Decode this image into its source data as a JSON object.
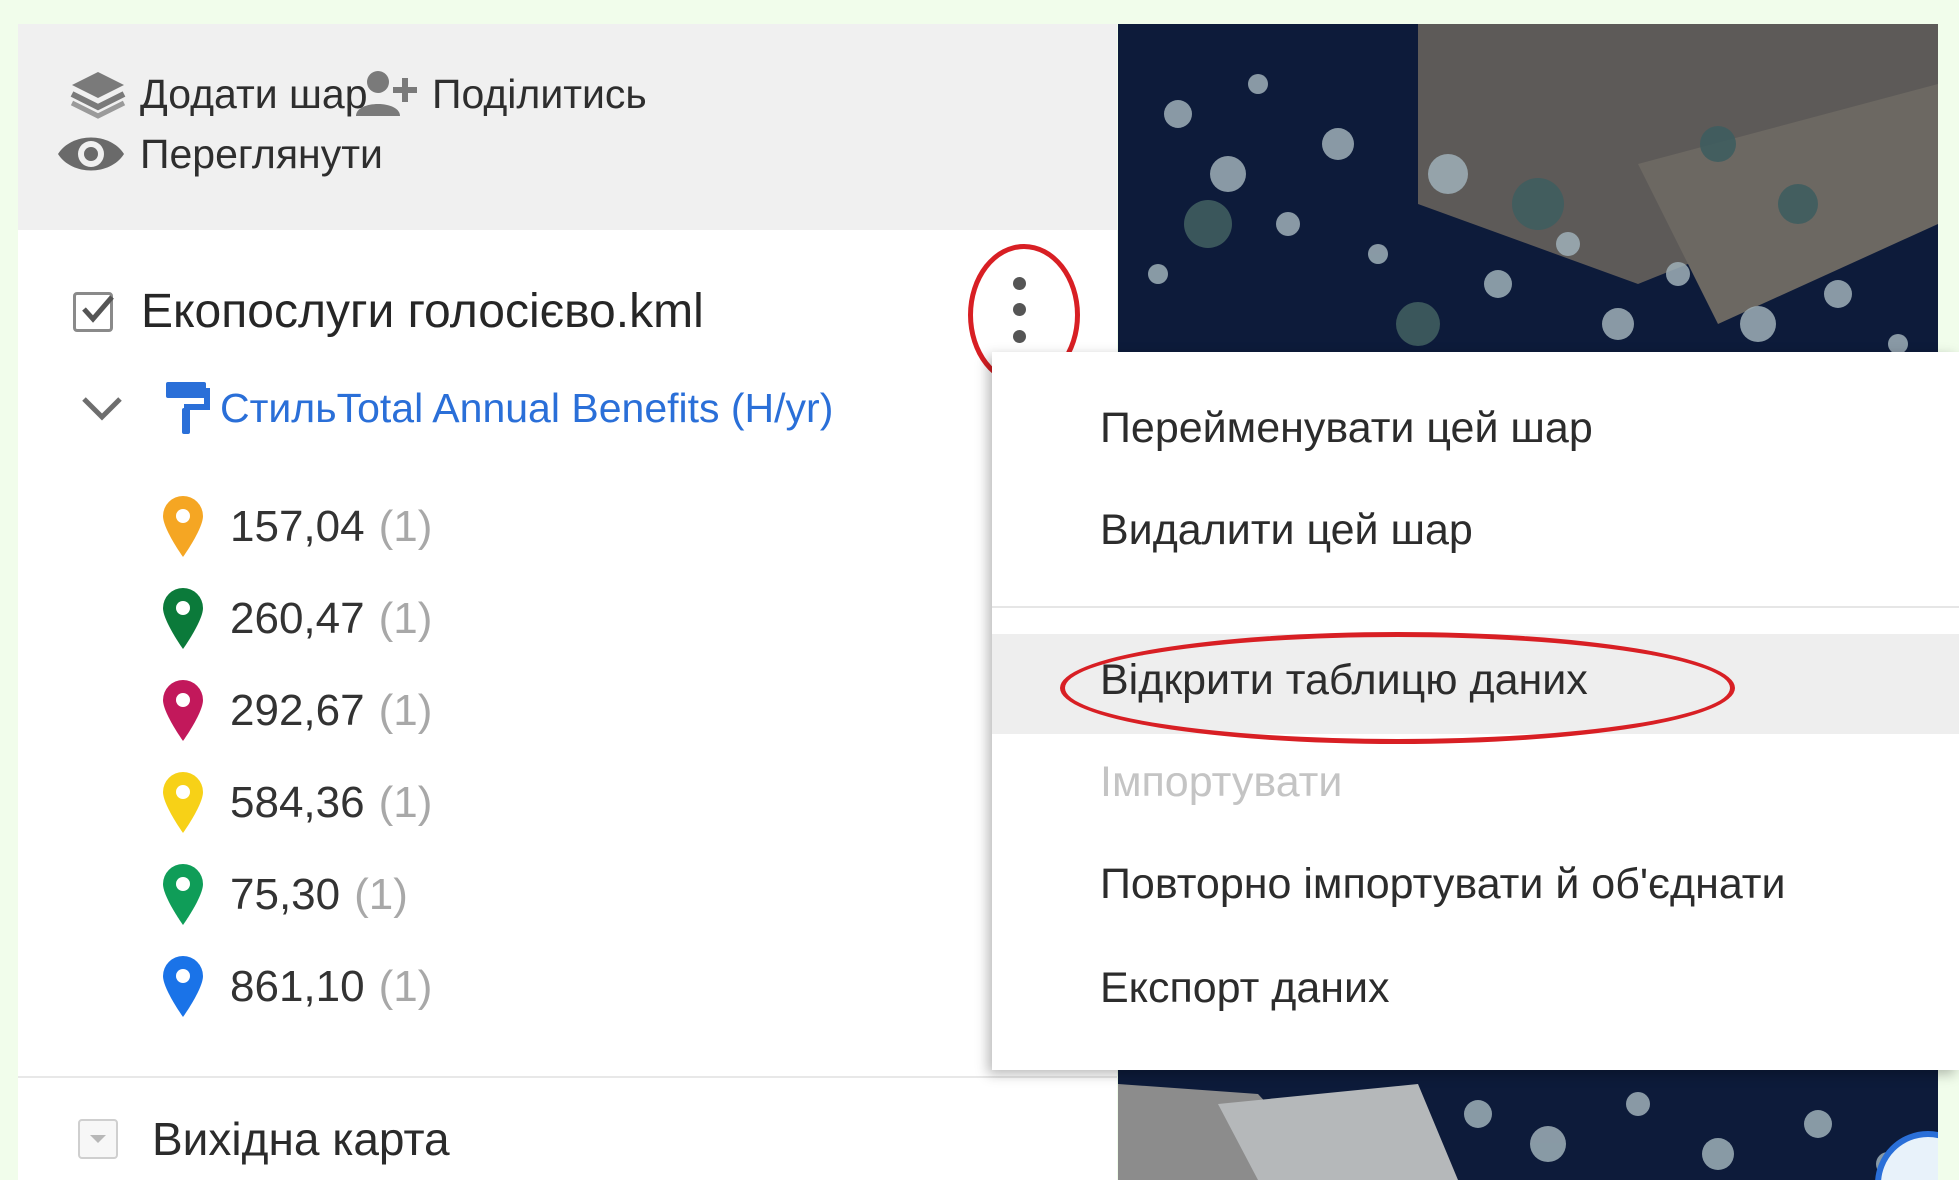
{
  "toolbar": {
    "add_layer": "Додати шар",
    "share": "Поділитись",
    "preview": "Переглянути"
  },
  "layer": {
    "name": "Екопослуги голосієво.kml",
    "checked": true,
    "style_label": "СтильTotal Annual Benefits (H/yr)"
  },
  "legend": [
    {
      "value": "157,04",
      "count": "(1)",
      "color": "#f5a623"
    },
    {
      "value": "260,47",
      "count": "(1)",
      "color": "#0b7a3a"
    },
    {
      "value": "292,67",
      "count": "(1)",
      "color": "#c2185b"
    },
    {
      "value": "584,36",
      "count": "(1)",
      "color": "#f7d117"
    },
    {
      "value": "75,30",
      "count": "(1)",
      "color": "#0f9d58"
    },
    {
      "value": "861,10",
      "count": "(1)",
      "color": "#1a73e8"
    }
  ],
  "basemap": {
    "label": "Вихідна карта"
  },
  "menu": {
    "rename": "Перейменувати цей шар",
    "delete": "Видалити цей шар",
    "open_table": "Відкрити таблицю даних",
    "import": "Імпортувати",
    "reimport": "Повторно імпортувати й об'єднати",
    "export": "Експорт даних"
  },
  "colors": {
    "annotation_red": "#d81f24",
    "link_blue": "#2a6fd8",
    "toolbar_bg": "#f0f0f0",
    "page_bg": "#f1fdeb"
  },
  "icons": [
    "layers-icon",
    "add-person-icon",
    "eye-icon",
    "checkbox-icon",
    "more-vert-icon",
    "chevron-down-icon",
    "paint-roller-icon",
    "map-pin-icon"
  ]
}
